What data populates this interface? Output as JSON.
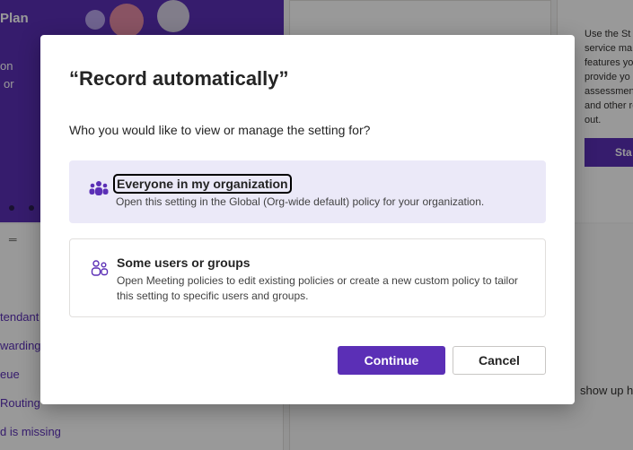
{
  "background": {
    "hero": {
      "plan_text": "Plan",
      "line1": "on",
      "line2": "or"
    },
    "right_panel": {
      "text": "Use the St service ma features yo provide yo assessmen and other roll out.",
      "button_label": "Sta"
    },
    "list_items": [
      "tendant",
      "warding",
      "eue",
      "Routing",
      "d is missing"
    ],
    "lower_text": "show up h"
  },
  "dialog": {
    "title": "“Record automatically”",
    "question": "Who you would like to view or manage the setting for?",
    "options": [
      {
        "title": "Everyone in my organization",
        "description": "Open this setting in the Global (Org-wide default) policy for your organization.",
        "selected": true,
        "icon": "people-team-icon"
      },
      {
        "title": "Some users or groups",
        "description": "Open Meeting policies to edit existing policies or create a new custom policy to tailor this setting to specific users and groups.",
        "selected": false,
        "icon": "people-outline-icon"
      }
    ],
    "continue_label": "Continue",
    "cancel_label": "Cancel",
    "accent_color": "#5b2fb6"
  }
}
